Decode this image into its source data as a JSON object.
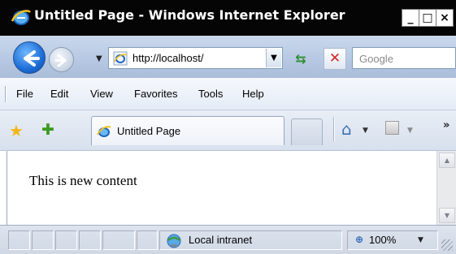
{
  "window": {
    "title": "Untitled Page - Windows Internet Explorer",
    "minimize_label": "_",
    "maximize_label": "□",
    "close_label": "×"
  },
  "address_bar": {
    "url": "http://localhost/",
    "dropdown_glyph": "▼",
    "refresh_glyph": "⇆",
    "stop_glyph": "✕"
  },
  "search": {
    "placeholder": "Google"
  },
  "menu": {
    "items": [
      "File",
      "Edit",
      "View",
      "Favorites",
      "Tools",
      "Help"
    ]
  },
  "tabs": {
    "active_label": "Untitled Page"
  },
  "toolbar": {
    "home_glyph": "⌂",
    "dropdown_glyph": "▼",
    "chevron": "»",
    "favorites_glyph": "★",
    "add_favorite_glyph": "✚"
  },
  "content": {
    "text": "This is new content"
  },
  "status": {
    "zone": "Local intranet",
    "zoom": "100%",
    "zoom_glyph": "⊕",
    "dropdown_glyph": "▼"
  },
  "colors": {
    "titlebar": "#050505",
    "accent": "#1c6dd6"
  }
}
